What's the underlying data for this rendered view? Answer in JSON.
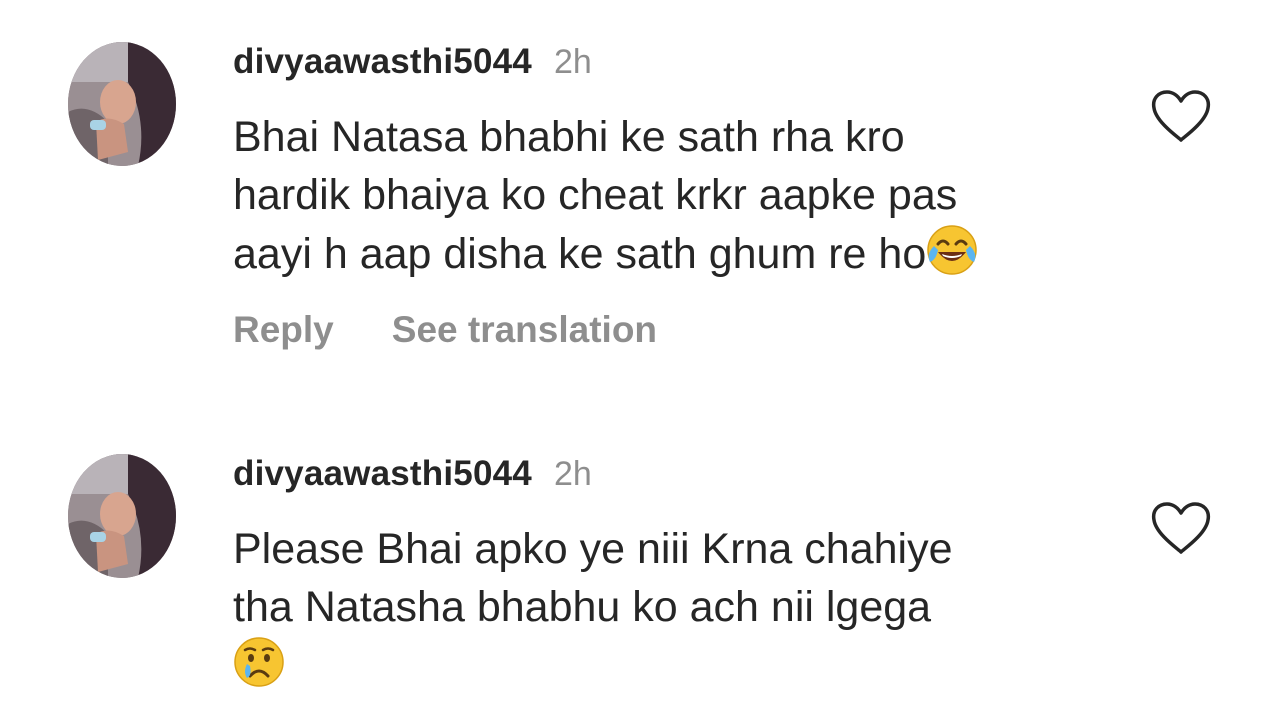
{
  "comments": [
    {
      "username": "divyaawasthi5044",
      "time": "2h",
      "lines": [
        "Bhai Natasa bhabhi ke sath rha kro",
        "hardik bhaiya ko cheat krkr aapke pas",
        "aayi h aap disha ke sath ghum re ho"
      ],
      "emoji": "😂",
      "emoji_icon": "face-with-tears-of-joy-icon",
      "reply_label": "Reply",
      "translation_label": "See translation"
    },
    {
      "username": "divyaawasthi5044",
      "time": "2h",
      "lines": [
        "Please Bhai apko ye niii Krna chahiye",
        "tha Natasha bhabhu ko ach nii lgega"
      ],
      "emoji": "😢",
      "emoji_icon": "crying-face-icon"
    }
  ],
  "colors": {
    "text": "#262626",
    "muted": "#8e8e8e",
    "background": "#ffffff"
  }
}
